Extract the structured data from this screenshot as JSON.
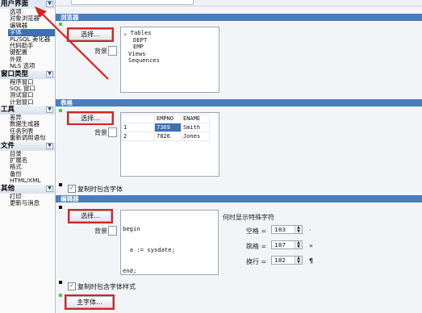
{
  "nav": {
    "groups": [
      {
        "title": "用户界面",
        "items": [
          "选项",
          "对象浏览器",
          "编辑器",
          "字体",
          "PL/SQL 美化器",
          "代码助手",
          "键配置",
          "外观",
          "NLS 选项"
        ],
        "selected": 3
      },
      {
        "title": "窗口类型",
        "items": [
          "程序窗口",
          "SQL 窗口",
          "测试窗口",
          "计划窗口"
        ]
      },
      {
        "title": "工具",
        "items": [
          "差异",
          "数据生成器",
          "任务列表",
          "重新调用语句"
        ]
      },
      {
        "title": "文件",
        "items": [
          "目录",
          "扩展名",
          "格式",
          "备份",
          "HTML/XML"
        ]
      },
      {
        "title": "其他",
        "items": [
          "打印",
          "更新与消息"
        ]
      }
    ]
  },
  "sections": {
    "browser": {
      "title": "浏览器",
      "select_label": "选择...",
      "bg_label": "背景",
      "tree": [
        "Tables",
        "DEPT",
        "EMP",
        "Views",
        "Sequences"
      ]
    },
    "grid": {
      "title": "表格",
      "select_label": "选择...",
      "bg_label": "背景",
      "columns": [
        "EMPNO",
        "ENAME"
      ],
      "rows": [
        {
          "num": "1",
          "empno": "7369",
          "ename": "Smith"
        },
        {
          "num": "2",
          "empno": "7826",
          "ename": "Jones"
        }
      ],
      "include_style_label": "复制时包含字体"
    },
    "editor": {
      "title": "编辑器",
      "select_label": "选择...",
      "bg_label": "背景",
      "code": [
        "begin",
        "  a := sysdate;",
        "end;"
      ],
      "special_chars_label": "何时显示特殊字符",
      "space_label": "空格 =",
      "space_value": "183",
      "space_symbol": "·",
      "tab_label": "跳格 =",
      "tab_value": "187",
      "tab_symbol": "»",
      "newline_label": "换行 =",
      "newline_value": "182",
      "newline_symbol": "¶",
      "include_style_label": "复制时包含字体样式"
    },
    "main_font": {
      "button_label": "主字体..."
    }
  },
  "icons": {
    "chevron": "chevron-down-icon",
    "checkbox": "check-icon",
    "spin": "spin-arrows-icon"
  },
  "colors": {
    "section_header": "#4a7cc0",
    "highlight_box": "#d92121",
    "selection": "#3d6fb5"
  }
}
